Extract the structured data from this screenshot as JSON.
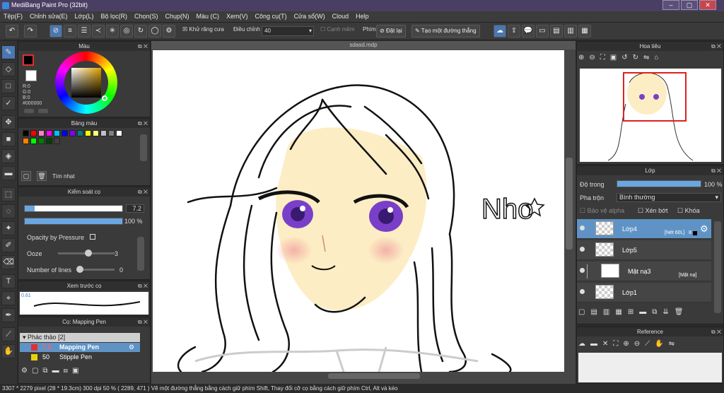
{
  "window": {
    "title": "MediBang Paint Pro (32bit)",
    "buttons": [
      "–",
      "▢",
      "✕"
    ]
  },
  "menu": [
    "Tệp(F)",
    "Chỉnh sửa(E)",
    "Lớp(L)",
    "Bộ lọc(R)",
    "Chọn(S)",
    "Chụp(N)",
    "Màu (C)",
    "Xem(V)",
    "Công cụ(T)",
    "Cửa sổ(W)",
    "Cloud",
    "Help"
  ],
  "toolbar": {
    "antialias_label": "Khử răng cưa",
    "correction_label": "Điều chỉnh",
    "correction_value": "40",
    "edge_label": "Cạnh mềm",
    "key_label": "Phím",
    "reset_label": "Đặt lại",
    "straight_line_label": "Tạo một đường thẳng"
  },
  "color_panel": {
    "title": "Màu",
    "readout": [
      "R:0",
      "G:0",
      "B:0",
      "#000000"
    ],
    "primary_color": "#000000",
    "secondary_color": "#ffffff"
  },
  "palette_panel": {
    "title": "Bảng màu",
    "swatches": [
      "#000000",
      "#ff0000",
      "#ff80c0",
      "#ff00ff",
      "#00c0ff",
      "#0000ff",
      "#8000ff",
      "#008080",
      "#ffff00",
      "#ffff80",
      "#c0c0c0",
      "#808080",
      "#ffffff",
      "#ff8000",
      "#00ff00",
      "#008000",
      "#004000",
      "#404040"
    ],
    "search_label": "Tìm nhạt"
  },
  "brush_control": {
    "title": "Kiểm soát cọ",
    "size_value": "7.2",
    "opacity_value": "100 %",
    "size_fraction": 0.1,
    "opacity_fraction": 1.0,
    "opacity_pressure_label": "Opacity by Pressure",
    "ooze_label": "Ooze",
    "ooze_value": "3",
    "lines_label": "Number of lines",
    "lines_value": "0"
  },
  "brush_preview": {
    "title": "Xem trước cọ",
    "size_text": "0.61"
  },
  "brush_list": {
    "title": "Cọ: Mapping Pen",
    "group": "Phác thảo [2]",
    "items": [
      {
        "size": "7.2",
        "name": "Mapping Pen",
        "color": "#e03030"
      },
      {
        "size": "50",
        "name": "Stipple Pen",
        "color": "#e8d010"
      }
    ]
  },
  "document": {
    "tab": "sdasd.mdp",
    "signature": "Nho"
  },
  "navigator": {
    "title": "Hoa tiêu"
  },
  "layers_panel": {
    "title": "Lớp",
    "opacity_label": "Độ trong",
    "opacity_value": "100 %",
    "blend_label": "Pha trộn",
    "blend_value": "Bình thường",
    "protect_alpha": "Bảo vệ alpha",
    "clipping": "Xén bớt",
    "lock": "Khóa",
    "layers": [
      {
        "name": "Lớp4",
        "tag": "[Nét 60L]",
        "extra": "8"
      },
      {
        "name": "Lớp5",
        "tag": "",
        "extra": ""
      },
      {
        "name": "Mặt nạ3",
        "tag": "[Mặt nạ]",
        "extra": ""
      },
      {
        "name": "Lớp1",
        "tag": "",
        "extra": ""
      }
    ]
  },
  "reference_panel": {
    "title": "Reference"
  },
  "status": "3307 * 2279 pixel  (28 * 19.3cm)  300 dpi  50 %  ( 2289, 471 )  Vẽ một đường thẳng bằng cách giữ phím Shift, Thay đổi cỡ cọ bằng cách giữ phím Ctrl, Alt và kéo"
}
